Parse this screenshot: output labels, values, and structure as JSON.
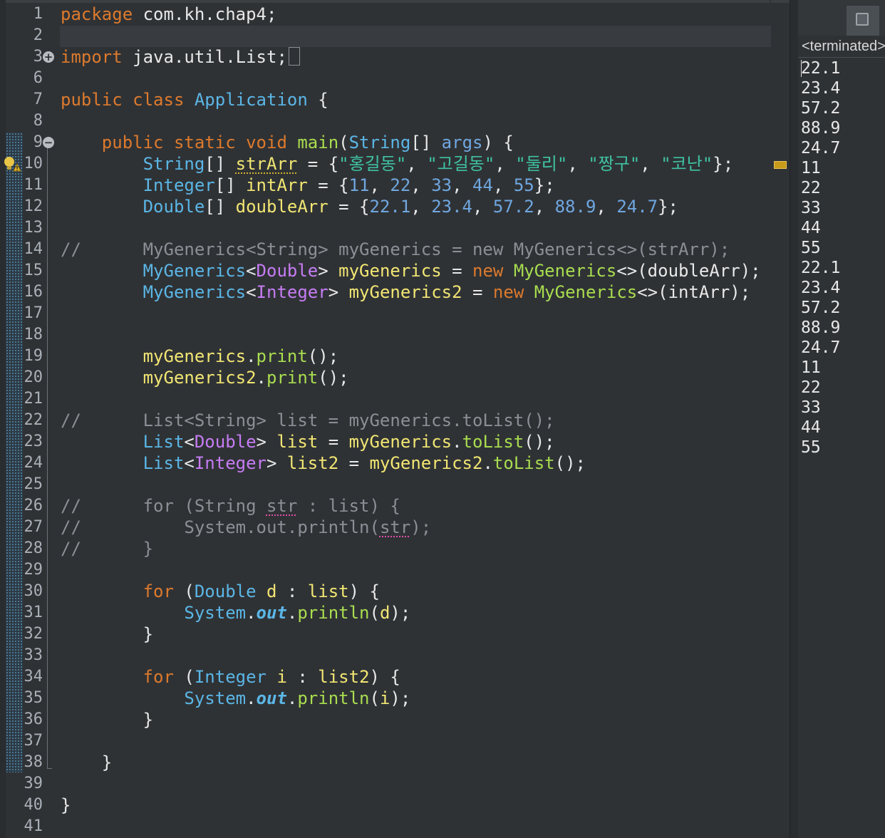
{
  "editor": {
    "lines": [
      {
        "n": "1",
        "parts": [
          {
            "t": "package",
            "c": "k"
          },
          {
            "t": " com.kh.chap4;",
            "c": "p"
          }
        ]
      },
      {
        "n": "2",
        "parts": []
      },
      {
        "n": "3",
        "parts": [
          {
            "t": "import",
            "c": "k"
          },
          {
            "t": " java.util.List;",
            "c": "p"
          }
        ],
        "fold": "+",
        "ellipsis": true
      },
      {
        "n": "6",
        "parts": []
      },
      {
        "n": "7",
        "parts": [
          {
            "t": "public",
            "c": "k"
          },
          {
            "t": " ",
            "c": "p"
          },
          {
            "t": "class",
            "c": "k"
          },
          {
            "t": " ",
            "c": "p"
          },
          {
            "t": "Application",
            "c": "t"
          },
          {
            "t": " {",
            "c": "p"
          }
        ]
      },
      {
        "n": "8",
        "parts": []
      },
      {
        "n": "9",
        "parts": [
          {
            "t": "    ",
            "c": "p"
          },
          {
            "t": "public",
            "c": "k"
          },
          {
            "t": " ",
            "c": "p"
          },
          {
            "t": "static",
            "c": "k"
          },
          {
            "t": " ",
            "c": "p"
          },
          {
            "t": "void",
            "c": "k"
          },
          {
            "t": " ",
            "c": "p"
          },
          {
            "t": "main",
            "c": "m"
          },
          {
            "t": "(",
            "c": "p"
          },
          {
            "t": "String",
            "c": "t"
          },
          {
            "t": "[] ",
            "c": "p"
          },
          {
            "t": "args",
            "c": "n"
          },
          {
            "t": ") {",
            "c": "p"
          }
        ],
        "fold": "−"
      },
      {
        "n": "10",
        "parts": [
          {
            "t": "        ",
            "c": "p"
          },
          {
            "t": "String",
            "c": "t"
          },
          {
            "t": "[] ",
            "c": "p"
          },
          {
            "t": "strArr",
            "c": "f",
            "u": "warn"
          },
          {
            "t": " = {",
            "c": "p"
          },
          {
            "t": "\"홍길동\"",
            "c": "s"
          },
          {
            "t": ", ",
            "c": "p"
          },
          {
            "t": "\"고길동\"",
            "c": "s"
          },
          {
            "t": ", ",
            "c": "p"
          },
          {
            "t": "\"둘리\"",
            "c": "s"
          },
          {
            "t": ", ",
            "c": "p"
          },
          {
            "t": "\"짱구\"",
            "c": "s"
          },
          {
            "t": ", ",
            "c": "p"
          },
          {
            "t": "\"코난\"",
            "c": "s"
          },
          {
            "t": "};",
            "c": "p"
          }
        ],
        "warn": true
      },
      {
        "n": "11",
        "parts": [
          {
            "t": "        ",
            "c": "p"
          },
          {
            "t": "Integer",
            "c": "t"
          },
          {
            "t": "[] ",
            "c": "p"
          },
          {
            "t": "intArr",
            "c": "f"
          },
          {
            "t": " = {",
            "c": "p"
          },
          {
            "t": "11",
            "c": "n"
          },
          {
            "t": ", ",
            "c": "p"
          },
          {
            "t": "22",
            "c": "n"
          },
          {
            "t": ", ",
            "c": "p"
          },
          {
            "t": "33",
            "c": "n"
          },
          {
            "t": ", ",
            "c": "p"
          },
          {
            "t": "44",
            "c": "n"
          },
          {
            "t": ", ",
            "c": "p"
          },
          {
            "t": "55",
            "c": "n"
          },
          {
            "t": "};",
            "c": "p"
          }
        ]
      },
      {
        "n": "12",
        "parts": [
          {
            "t": "        ",
            "c": "p"
          },
          {
            "t": "Double",
            "c": "t"
          },
          {
            "t": "[] ",
            "c": "p"
          },
          {
            "t": "doubleArr",
            "c": "f"
          },
          {
            "t": " = {",
            "c": "p"
          },
          {
            "t": "22.1",
            "c": "n"
          },
          {
            "t": ", ",
            "c": "p"
          },
          {
            "t": "23.4",
            "c": "n"
          },
          {
            "t": ", ",
            "c": "p"
          },
          {
            "t": "57.2",
            "c": "n"
          },
          {
            "t": ", ",
            "c": "p"
          },
          {
            "t": "88.9",
            "c": "n"
          },
          {
            "t": ", ",
            "c": "p"
          },
          {
            "t": "24.7",
            "c": "n"
          },
          {
            "t": "};",
            "c": "p"
          }
        ]
      },
      {
        "n": "13",
        "parts": []
      },
      {
        "n": "14",
        "parts": [
          {
            "t": "//      MyGenerics<String> myGenerics = new MyGenerics<>(strArr);",
            "c": "c"
          }
        ]
      },
      {
        "n": "15",
        "parts": [
          {
            "t": "        ",
            "c": "p"
          },
          {
            "t": "MyGenerics",
            "c": "t"
          },
          {
            "t": "<",
            "c": "p"
          },
          {
            "t": "Double",
            "c": "g"
          },
          {
            "t": "> ",
            "c": "p"
          },
          {
            "t": "myGenerics",
            "c": "f"
          },
          {
            "t": " = ",
            "c": "p"
          },
          {
            "t": "new",
            "c": "k"
          },
          {
            "t": " ",
            "c": "p"
          },
          {
            "t": "MyGenerics",
            "c": "m"
          },
          {
            "t": "<>(doubleArr);",
            "c": "p"
          }
        ]
      },
      {
        "n": "16",
        "parts": [
          {
            "t": "        ",
            "c": "p"
          },
          {
            "t": "MyGenerics",
            "c": "t"
          },
          {
            "t": "<",
            "c": "p"
          },
          {
            "t": "Integer",
            "c": "g"
          },
          {
            "t": "> ",
            "c": "p"
          },
          {
            "t": "myGenerics2",
            "c": "f"
          },
          {
            "t": " = ",
            "c": "p"
          },
          {
            "t": "new",
            "c": "k"
          },
          {
            "t": " ",
            "c": "p"
          },
          {
            "t": "MyGenerics",
            "c": "m"
          },
          {
            "t": "<>(intArr);",
            "c": "p"
          }
        ]
      },
      {
        "n": "17",
        "parts": []
      },
      {
        "n": "18",
        "parts": []
      },
      {
        "n": "19",
        "parts": [
          {
            "t": "        ",
            "c": "p"
          },
          {
            "t": "myGenerics",
            "c": "f"
          },
          {
            "t": ".",
            "c": "p"
          },
          {
            "t": "print",
            "c": "m"
          },
          {
            "t": "();",
            "c": "p"
          }
        ]
      },
      {
        "n": "20",
        "parts": [
          {
            "t": "        ",
            "c": "p"
          },
          {
            "t": "myGenerics2",
            "c": "f"
          },
          {
            "t": ".",
            "c": "p"
          },
          {
            "t": "print",
            "c": "m"
          },
          {
            "t": "();",
            "c": "p"
          }
        ]
      },
      {
        "n": "21",
        "parts": []
      },
      {
        "n": "22",
        "parts": [
          {
            "t": "//      List<String> list = myGenerics.toList();",
            "c": "c"
          }
        ]
      },
      {
        "n": "23",
        "parts": [
          {
            "t": "        ",
            "c": "p"
          },
          {
            "t": "List",
            "c": "t"
          },
          {
            "t": "<",
            "c": "p"
          },
          {
            "t": "Double",
            "c": "g"
          },
          {
            "t": "> ",
            "c": "p"
          },
          {
            "t": "list",
            "c": "f"
          },
          {
            "t": " = ",
            "c": "p"
          },
          {
            "t": "myGenerics",
            "c": "f"
          },
          {
            "t": ".",
            "c": "p"
          },
          {
            "t": "toList",
            "c": "m"
          },
          {
            "t": "();",
            "c": "p"
          }
        ]
      },
      {
        "n": "24",
        "parts": [
          {
            "t": "        ",
            "c": "p"
          },
          {
            "t": "List",
            "c": "t"
          },
          {
            "t": "<",
            "c": "p"
          },
          {
            "t": "Integer",
            "c": "g"
          },
          {
            "t": "> ",
            "c": "p"
          },
          {
            "t": "list2",
            "c": "f"
          },
          {
            "t": " = ",
            "c": "p"
          },
          {
            "t": "myGenerics2",
            "c": "f"
          },
          {
            "t": ".",
            "c": "p"
          },
          {
            "t": "toList",
            "c": "m"
          },
          {
            "t": "();",
            "c": "p"
          }
        ]
      },
      {
        "n": "25",
        "parts": []
      },
      {
        "n": "26",
        "parts": [
          {
            "t": "//      for (String ",
            "c": "c"
          },
          {
            "t": "str",
            "c": "c",
            "u": "err"
          },
          {
            "t": " : list) {",
            "c": "c"
          }
        ]
      },
      {
        "n": "27",
        "parts": [
          {
            "t": "//          System.out.println(",
            "c": "c"
          },
          {
            "t": "str",
            "c": "c",
            "u": "err"
          },
          {
            "t": ");",
            "c": "c"
          }
        ]
      },
      {
        "n": "28",
        "parts": [
          {
            "t": "//      }",
            "c": "c"
          }
        ]
      },
      {
        "n": "29",
        "parts": []
      },
      {
        "n": "30",
        "parts": [
          {
            "t": "        ",
            "c": "p"
          },
          {
            "t": "for",
            "c": "k"
          },
          {
            "t": " (",
            "c": "p"
          },
          {
            "t": "Double",
            "c": "t"
          },
          {
            "t": " ",
            "c": "p"
          },
          {
            "t": "d",
            "c": "f"
          },
          {
            "t": " : ",
            "c": "p"
          },
          {
            "t": "list",
            "c": "f"
          },
          {
            "t": ") {",
            "c": "p"
          }
        ]
      },
      {
        "n": "31",
        "parts": [
          {
            "t": "            ",
            "c": "p"
          },
          {
            "t": "System",
            "c": "t"
          },
          {
            "t": ".",
            "c": "p"
          },
          {
            "t": "out",
            "c": "o"
          },
          {
            "t": ".",
            "c": "p"
          },
          {
            "t": "println",
            "c": "m"
          },
          {
            "t": "(",
            "c": "p"
          },
          {
            "t": "d",
            "c": "f"
          },
          {
            "t": ");",
            "c": "p"
          }
        ]
      },
      {
        "n": "32",
        "parts": [
          {
            "t": "        }",
            "c": "p"
          }
        ]
      },
      {
        "n": "33",
        "parts": []
      },
      {
        "n": "34",
        "parts": [
          {
            "t": "        ",
            "c": "p"
          },
          {
            "t": "for",
            "c": "k"
          },
          {
            "t": " (",
            "c": "p"
          },
          {
            "t": "Integer",
            "c": "t"
          },
          {
            "t": " ",
            "c": "p"
          },
          {
            "t": "i",
            "c": "f"
          },
          {
            "t": " : ",
            "c": "p"
          },
          {
            "t": "list2",
            "c": "f"
          },
          {
            "t": ") {",
            "c": "p"
          }
        ]
      },
      {
        "n": "35",
        "parts": [
          {
            "t": "            ",
            "c": "p"
          },
          {
            "t": "System",
            "c": "t"
          },
          {
            "t": ".",
            "c": "p"
          },
          {
            "t": "out",
            "c": "o"
          },
          {
            "t": ".",
            "c": "p"
          },
          {
            "t": "println",
            "c": "m"
          },
          {
            "t": "(",
            "c": "p"
          },
          {
            "t": "i",
            "c": "f"
          },
          {
            "t": ");",
            "c": "p"
          }
        ]
      },
      {
        "n": "36",
        "parts": [
          {
            "t": "        }",
            "c": "p"
          }
        ]
      },
      {
        "n": "37",
        "parts": []
      },
      {
        "n": "38",
        "parts": [
          {
            "t": "    }",
            "c": "p"
          }
        ]
      },
      {
        "n": "39",
        "parts": []
      },
      {
        "n": "40",
        "parts": [
          {
            "t": "}",
            "c": "p"
          }
        ]
      },
      {
        "n": "41",
        "parts": []
      }
    ]
  },
  "console": {
    "header": "<terminated>",
    "output": [
      "22.1",
      "23.4",
      "57.2",
      "88.9",
      "24.7",
      "11",
      "22",
      "33",
      "44",
      "55",
      "22.1",
      "23.4",
      "57.2",
      "88.9",
      "24.7",
      "11",
      "22",
      "33",
      "44",
      "55"
    ]
  },
  "colors": {
    "background": "#2f3235",
    "keyword": "#dd7a2d",
    "type": "#5bb6e6",
    "string": "#3fc2a3",
    "number": "#6fa7e0",
    "field": "#f2e673",
    "method": "#a9dd4f",
    "generic": "#c67cf4",
    "comment": "#8b9096"
  },
  "icons": {
    "fold_expand": "plus-circle-icon",
    "fold_collapse": "minus-circle-icon",
    "warning": "warning-lightbulb-icon",
    "maximize": "maximize-icon"
  }
}
